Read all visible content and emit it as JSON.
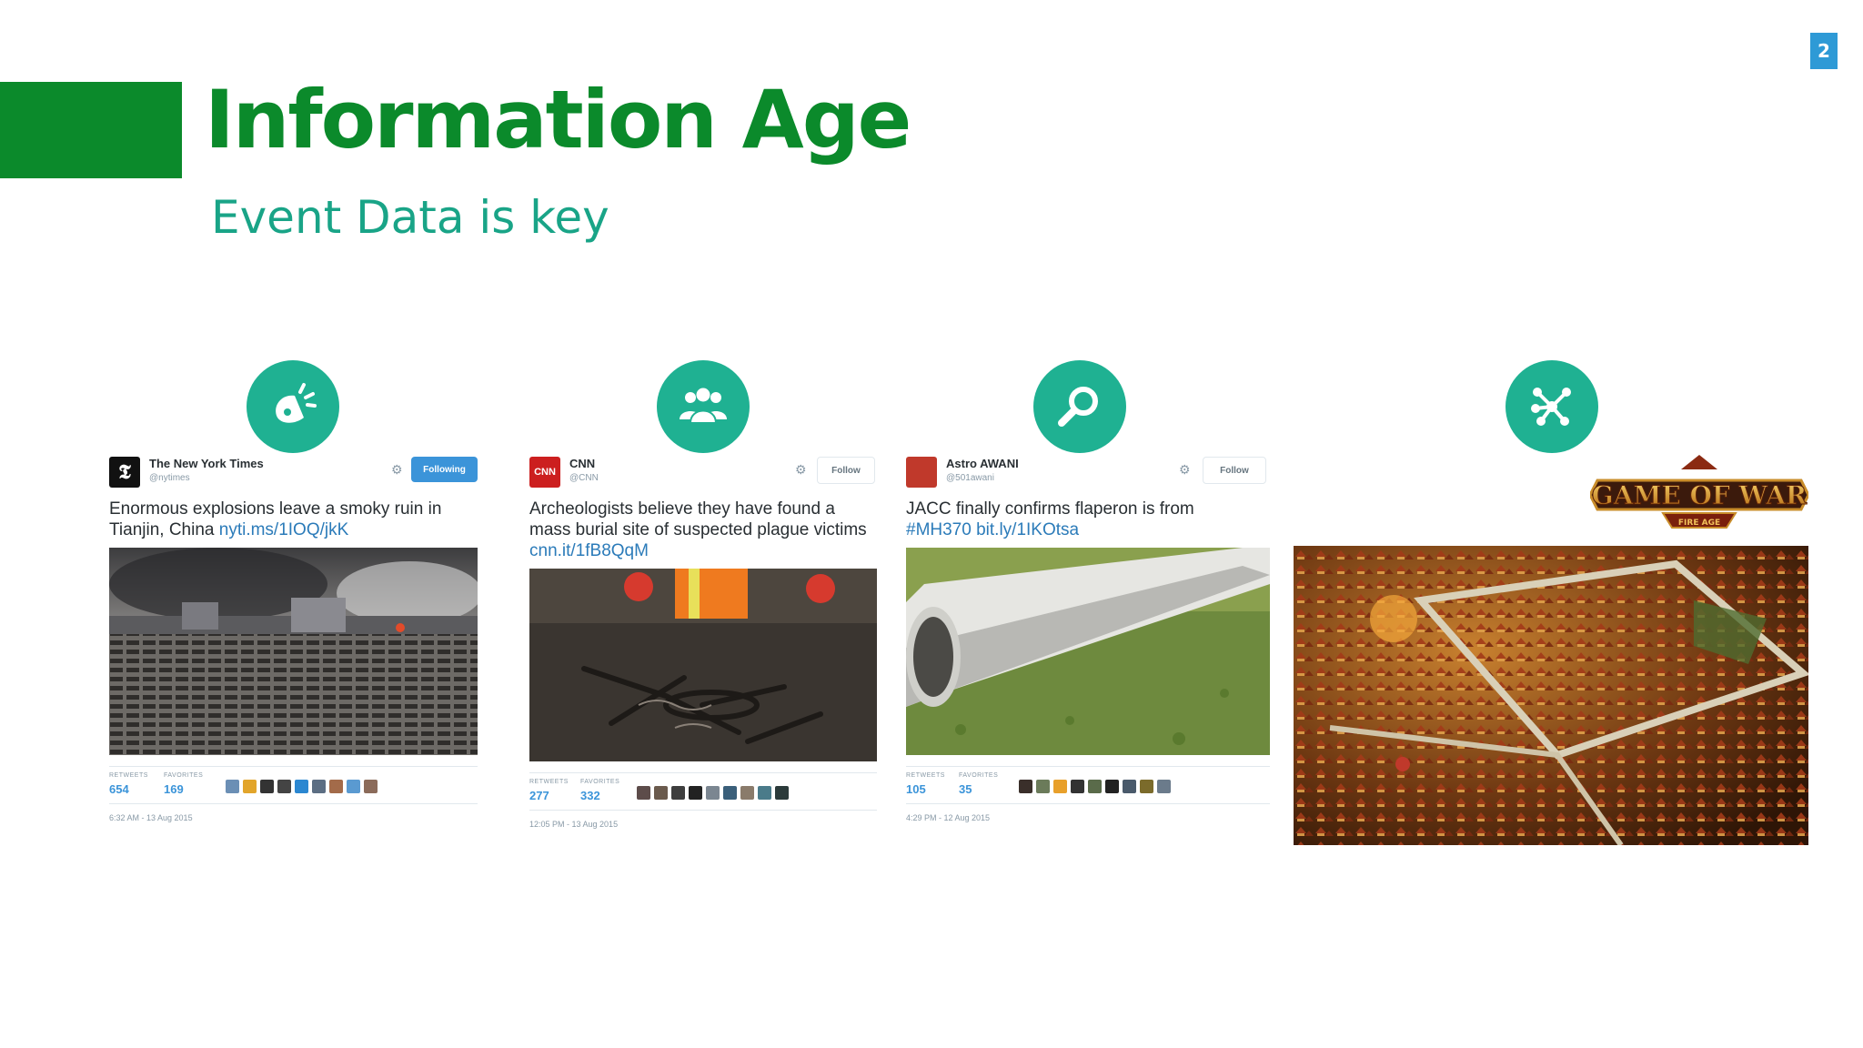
{
  "slide": {
    "number": "2",
    "title": "Information Age",
    "subtitle": "Event Data is key"
  },
  "icons": [
    {
      "name": "megaphone-icon"
    },
    {
      "name": "group-icon"
    },
    {
      "name": "search-icon"
    },
    {
      "name": "network-icon"
    }
  ],
  "tweets": [
    {
      "account": "The New York Times",
      "handle": "@nytimes",
      "follow_label": "Following",
      "text": "Enormous explosions leave a smoky ruin in Tianjin, China",
      "link": "nyti.ms/1IOQ/jkK",
      "stat1_label": "RETWEETS",
      "stat1_value": "654",
      "stat2_label": "FAVORITES",
      "stat2_value": "169",
      "time": "6:32 AM - 13 Aug 2015"
    },
    {
      "account": "CNN",
      "handle": "@CNN",
      "follow_label": "Follow",
      "text": "Archeologists believe they have found a mass burial site of suspected plague victims",
      "link": "cnn.it/1fB8QqM",
      "stat1_label": "RETWEETS",
      "stat1_value": "277",
      "stat2_label": "FAVORITES",
      "stat2_value": "332",
      "time": "12:05 PM - 13 Aug 2015"
    },
    {
      "account": "Astro AWANI",
      "handle": "@501awani",
      "follow_label": "Follow",
      "text": "JACC finally confirms flaperon is from",
      "link": "#MH370 bit.ly/1IKOtsa",
      "stat1_label": "RETWEETS",
      "stat1_value": "105",
      "stat2_label": "FAVORITES",
      "stat2_value": "35",
      "time": "4:29 PM - 12 Aug 2015"
    }
  ],
  "game": {
    "logo_text": "GAME OF WAR",
    "logo_sub": "FIRE AGE"
  },
  "colors": {
    "title_green": "#0b8a2b",
    "subtitle_teal": "#19a487",
    "icon_teal": "#1fb192",
    "slide_number_blue": "#2e9ad6"
  }
}
